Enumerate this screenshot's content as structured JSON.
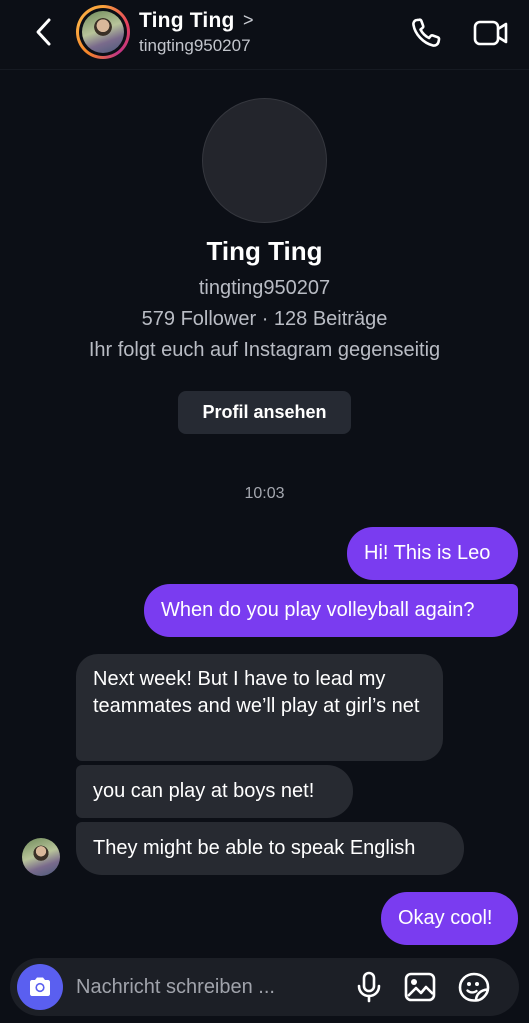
{
  "header": {
    "name": "Ting Ting",
    "chevron": ">",
    "username": "tingting950207",
    "icons": {
      "back": "chevron-left-icon",
      "call": "phone-icon",
      "video": "video-camera-icon"
    }
  },
  "profile": {
    "name": "Ting Ting",
    "username": "tingting950207",
    "stats": "579 Follower · 128 Beiträge",
    "mutual": "Ihr folgt euch auf Instagram gegenseitig",
    "view_profile_button": "Profil ansehen"
  },
  "conversation": {
    "timestamp": "10:03",
    "messages": [
      {
        "sender": "me",
        "text": "Hi! This is Leo"
      },
      {
        "sender": "me",
        "text": "When do you play volleyball again?"
      },
      {
        "sender": "them",
        "text": "Next week!  But I have to lead my teammates and we’ll play at girl’s net"
      },
      {
        "sender": "them",
        "text": "you can play at boys net!"
      },
      {
        "sender": "them",
        "text": "They might be able to speak English"
      },
      {
        "sender": "me",
        "text": "Okay cool!"
      }
    ]
  },
  "composer": {
    "placeholder": "Nachricht schreiben ...",
    "icons": {
      "camera": "camera-icon",
      "mic": "microphone-icon",
      "gallery": "image-icon",
      "sticker": "sticker-icon"
    }
  },
  "colors": {
    "background": "#0c0f16",
    "outgoing_bubble": "#7a3cf0",
    "incoming_bubble": "#272a31",
    "camera_button": "#5a5ff0"
  }
}
